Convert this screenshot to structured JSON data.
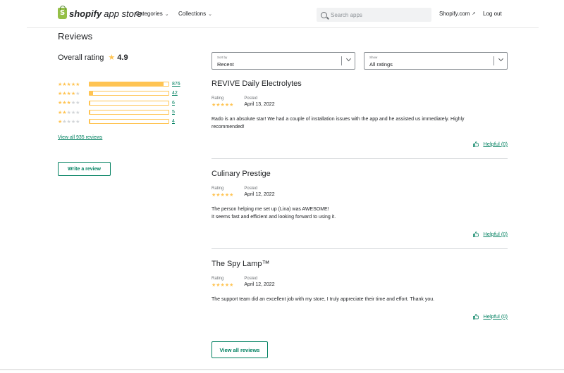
{
  "header": {
    "logo_bold": "shopify",
    "logo_rest": "app store",
    "nav": [
      {
        "label": "Categories"
      },
      {
        "label": "Collections"
      }
    ],
    "search_placeholder": "Search apps",
    "shopify_link": "Shopify.com",
    "logout": "Log out"
  },
  "left": {
    "title": "Reviews",
    "overall_label": "Overall rating",
    "overall_value": "4.9",
    "distribution": [
      {
        "stars": 5,
        "count": "876",
        "fraction": 0.94
      },
      {
        "stars": 4,
        "count": "42",
        "fraction": 0.045
      },
      {
        "stars": 3,
        "count": "6",
        "fraction": 0.006
      },
      {
        "stars": 2,
        "count": "5",
        "fraction": 0.005
      },
      {
        "stars": 1,
        "count": "4",
        "fraction": 0.004
      }
    ],
    "view_all_link": "View all 935 reviews",
    "write_review": "Write a review"
  },
  "filters": {
    "sort_label": "Sort by",
    "sort_value": "Recent",
    "show_label": "Show",
    "show_value": "All ratings"
  },
  "reviews": [
    {
      "title": "REVIVE Daily Electrolytes",
      "rating_label": "Rating",
      "stars": "★★★★★",
      "posted_label": "Posted",
      "date": "April 13, 2022",
      "body_lines": [
        "Rado is an absolute star! We had a couple of installation issues with the app and he assisted us immediately. Highly",
        "recommended!"
      ],
      "helpful": "Helpful (0)"
    },
    {
      "title": "Culinary Prestige",
      "rating_label": "Rating",
      "stars": "★★★★★",
      "posted_label": "Posted",
      "date": "April 12, 2022",
      "body_lines": [
        "The person helping me set up (Lina) was AWESOME!",
        "It seems fast and efficient and looking forward to using it."
      ],
      "helpful": "Helpful (0)"
    },
    {
      "title": "The Spy Lamp™",
      "rating_label": "Rating",
      "stars": "★★★★★",
      "posted_label": "Posted",
      "date": "April 12, 2022",
      "body_lines": [
        "The support team did an excellent job with my store, I truly appreciate their time and effort. Thank you."
      ],
      "helpful": "Helpful (0)"
    }
  ],
  "view_all_button": "View all reviews",
  "colors": {
    "star": "#ffc453",
    "brand_green": "#008060",
    "logo_green": "#95bf47"
  }
}
